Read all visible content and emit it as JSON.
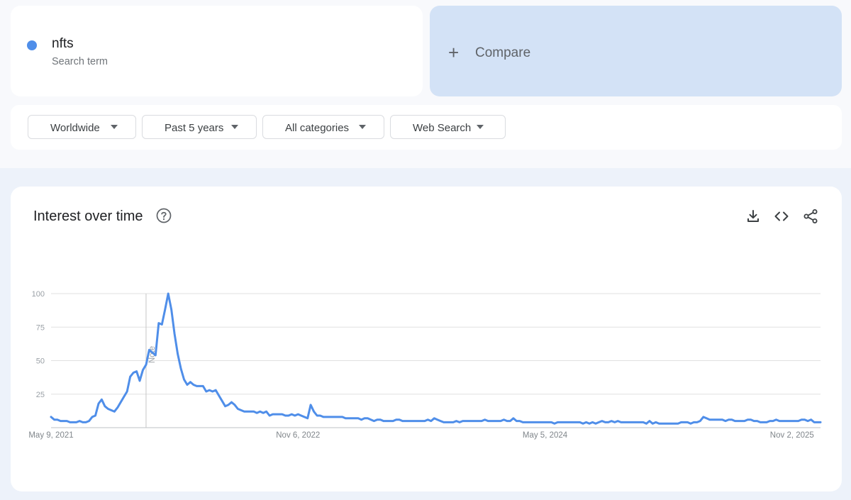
{
  "search_term": {
    "name": "nfts",
    "subtitle": "Search term",
    "color": "#4f8ee9"
  },
  "compare": {
    "icon": "plus-icon",
    "label": "Compare"
  },
  "filters": [
    {
      "label": "Worldwide"
    },
    {
      "label": "Past 5 years"
    },
    {
      "label": "All categories"
    },
    {
      "label": "Web Search"
    }
  ],
  "interest_card": {
    "title": "Interest over time",
    "icons": [
      "help-icon",
      "download-icon",
      "embed-icon",
      "share-icon"
    ]
  },
  "chart_data": {
    "type": "line",
    "title": "",
    "xlabel": "",
    "ylabel": "",
    "ylim": [
      0,
      100
    ],
    "y_ticks": [
      25,
      50,
      75,
      100
    ],
    "x_ticks": [
      "May 9, 2021",
      "Nov 6, 2022",
      "May 5, 2024",
      "Nov 2, 2025"
    ],
    "x_tick_index": [
      0,
      78,
      156,
      234
    ],
    "grid": true,
    "annotation": {
      "label": "Note",
      "index": 30
    },
    "line_color": "#4f8ee9",
    "series": [
      {
        "name": "nfts",
        "values": [
          8,
          6,
          6,
          5,
          5,
          5,
          4,
          4,
          4,
          5,
          4,
          4,
          5,
          8,
          9,
          18,
          21,
          16,
          14,
          13,
          12,
          15,
          19,
          23,
          27,
          38,
          41,
          42,
          35,
          43,
          47,
          58,
          56,
          54,
          78,
          77,
          88,
          100,
          88,
          70,
          55,
          44,
          36,
          32,
          34,
          32,
          31,
          31,
          31,
          27,
          28,
          27,
          28,
          24,
          20,
          16,
          17,
          19,
          17,
          14,
          13,
          12,
          12,
          12,
          12,
          11,
          12,
          11,
          12,
          9,
          10,
          10,
          10,
          10,
          9,
          9,
          10,
          9,
          10,
          9,
          8,
          7,
          17,
          12,
          9,
          9,
          8,
          8,
          8,
          8,
          8,
          8,
          8,
          7,
          7,
          7,
          7,
          7,
          6,
          7,
          7,
          6,
          5,
          6,
          6,
          5,
          5,
          5,
          5,
          6,
          6,
          5,
          5,
          5,
          5,
          5,
          5,
          5,
          5,
          6,
          5,
          7,
          6,
          5,
          4,
          4,
          4,
          4,
          5,
          4,
          5,
          5,
          5,
          5,
          5,
          5,
          5,
          6,
          5,
          5,
          5,
          5,
          5,
          6,
          5,
          5,
          7,
          5,
          5,
          4,
          4,
          4,
          4,
          4,
          4,
          4,
          4,
          4,
          4,
          3,
          4,
          4,
          4,
          4,
          4,
          4,
          4,
          4,
          3,
          4,
          3,
          4,
          3,
          4,
          5,
          4,
          4,
          5,
          4,
          5,
          4,
          4,
          4,
          4,
          4,
          4,
          4,
          4,
          3,
          5,
          3,
          4,
          3,
          3,
          3,
          3,
          3,
          3,
          3,
          4,
          4,
          4,
          3,
          4,
          4,
          5,
          8,
          7,
          6,
          6,
          6,
          6,
          6,
          5,
          6,
          6,
          5,
          5,
          5,
          5,
          6,
          6,
          5,
          5,
          4,
          4,
          4,
          5,
          5,
          6,
          5,
          5,
          5,
          5,
          5,
          5,
          5,
          6,
          6,
          5,
          6,
          4,
          4,
          4
        ]
      }
    ]
  }
}
